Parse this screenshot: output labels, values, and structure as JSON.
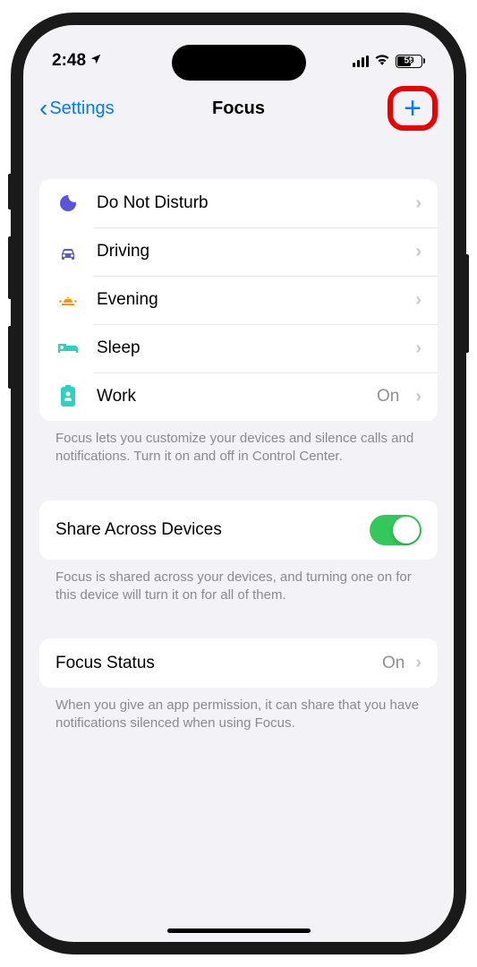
{
  "status": {
    "time": "2:48",
    "battery": "59"
  },
  "nav": {
    "back": "Settings",
    "title": "Focus"
  },
  "focus_modes": [
    {
      "icon": "moon",
      "label": "Do Not Disturb",
      "value": ""
    },
    {
      "icon": "car",
      "label": "Driving",
      "value": ""
    },
    {
      "icon": "sunset",
      "label": "Evening",
      "value": ""
    },
    {
      "icon": "bed",
      "label": "Sleep",
      "value": ""
    },
    {
      "icon": "badge",
      "label": "Work",
      "value": "On"
    }
  ],
  "focus_footer": "Focus lets you customize your devices and silence calls and notifications. Turn it on and off in Control Center.",
  "share": {
    "label": "Share Across Devices",
    "enabled": true,
    "footer": "Focus is shared across your devices, and turning one on for this device will turn it on for all of them."
  },
  "focus_status": {
    "label": "Focus Status",
    "value": "On",
    "footer": "When you give an app permission, it can share that you have notifications silenced when using Focus."
  }
}
